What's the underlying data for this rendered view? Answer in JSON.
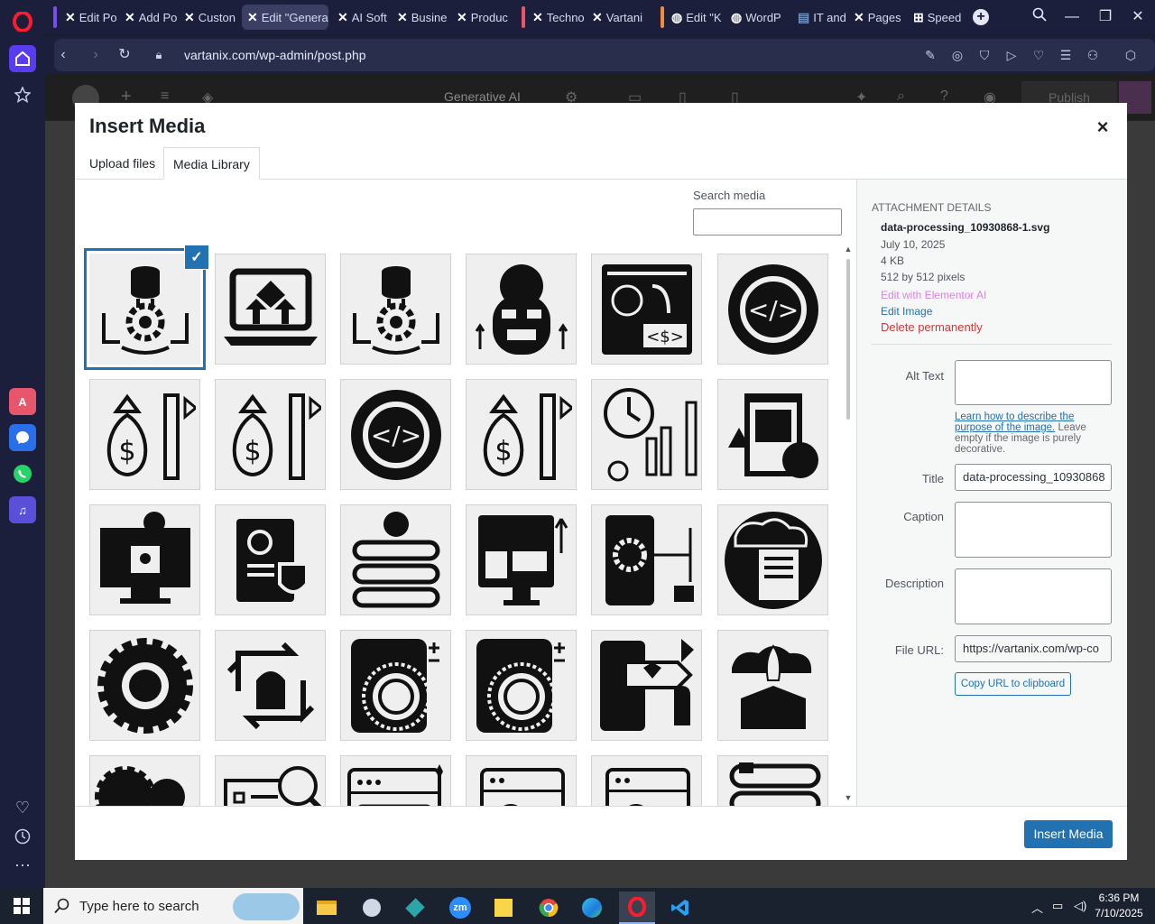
{
  "browser": {
    "tabs": [
      {
        "title": "Edit Po",
        "favicon": "elementor-x-icon",
        "active": false
      },
      {
        "title": "Add Po",
        "favicon": "elementor-x-icon",
        "active": false
      },
      {
        "title": "Custon",
        "favicon": "elementor-x-icon",
        "active": false
      },
      {
        "title": "Edit \"Genera",
        "favicon": "elementor-x-icon",
        "active": true
      },
      {
        "title": "AI Soft",
        "favicon": "elementor-x-icon",
        "active": false
      },
      {
        "title": "Busine",
        "favicon": "elementor-x-icon",
        "active": false
      },
      {
        "title": "Produc",
        "favicon": "elementor-x-icon",
        "active": false
      },
      {
        "title": "Techno",
        "favicon": "elementor-x-icon",
        "active": false
      },
      {
        "title": "Vartani",
        "favicon": "elementor-x-icon",
        "active": false
      },
      {
        "title": "Edit \"K",
        "favicon": "wordpress-icon",
        "active": false
      },
      {
        "title": "WordP",
        "favicon": "wordpress-icon",
        "active": false
      },
      {
        "title": "IT and",
        "favicon": "doc-icon",
        "active": false
      },
      {
        "title": "Pages",
        "favicon": "elementor-x-icon",
        "active": false
      },
      {
        "title": "Speed",
        "favicon": "speed-dial-icon",
        "active": false
      }
    ],
    "url": "vartanix.com/wp-admin/post.php"
  },
  "editor": {
    "ai_label": "Generative AI",
    "publish_label": "Publish"
  },
  "modal": {
    "title": "Insert Media",
    "close_label": "×",
    "tabs": {
      "upload": "Upload files",
      "library": "Media Library"
    },
    "search_label": "Search media",
    "search_placeholder": "",
    "grid_icons": [
      "data-processing-icon",
      "laptop-upload-icon",
      "data-processing-icon",
      "ai-robot-face-icon",
      "ai-brain-money-icon",
      "code-cycle-icon",
      "money-bag-chart-icon",
      "money-bag-chart-icon",
      "code-cycle-icon",
      "money-bag-chart-icon",
      "time-growth-chart-icon",
      "clipboard-warning-icon",
      "secure-monitor-icon",
      "copyright-shield-icon",
      "server-code-icon",
      "finance-dashboard-icon",
      "mobile-settings-icon",
      "cloud-document-icon",
      "settings-gear-icon",
      "product-cycle-icon",
      "ai-brain-phone-icon",
      "ai-brain-phone-icon",
      "mobile-premium-icon",
      "cloud-rocket-icon",
      "gears-team-icon",
      "checklist-search-icon",
      "web-editor-icon",
      "web-profile-icon",
      "web-profile-icon",
      "server-rack-icon"
    ],
    "insert_label": "Insert Media"
  },
  "attachment": {
    "heading": "Attachment Details",
    "filename": "data-processing_10930868-1.svg",
    "date": "July 10, 2025",
    "size": "4 KB",
    "dimensions": "512 by 512 pixels",
    "edit_elementor_ai": "Edit with Elementor AI",
    "edit_image": "Edit Image",
    "delete": "Delete permanently",
    "alt_text_label": "Alt Text",
    "alt_help_link": "Learn how to describe the purpose of the image.",
    "alt_help_rest": " Leave empty if the image is purely decorative.",
    "title_label": "Title",
    "title_value": "data-processing_10930868",
    "caption_label": "Caption",
    "description_label": "Description",
    "file_url_label": "File URL:",
    "file_url_value": "https://vartanix.com/wp-co",
    "copy_url_label": "Copy URL to clipboard"
  },
  "taskbar": {
    "search_placeholder": "Type here to search",
    "time": "6:36 PM",
    "date": "7/10/2025"
  },
  "colors": {
    "wp_blue": "#2271b1",
    "delete_red": "#d63638",
    "elementor_ai_pink": "#e080e6",
    "opera_red": "#ff1b2d"
  }
}
